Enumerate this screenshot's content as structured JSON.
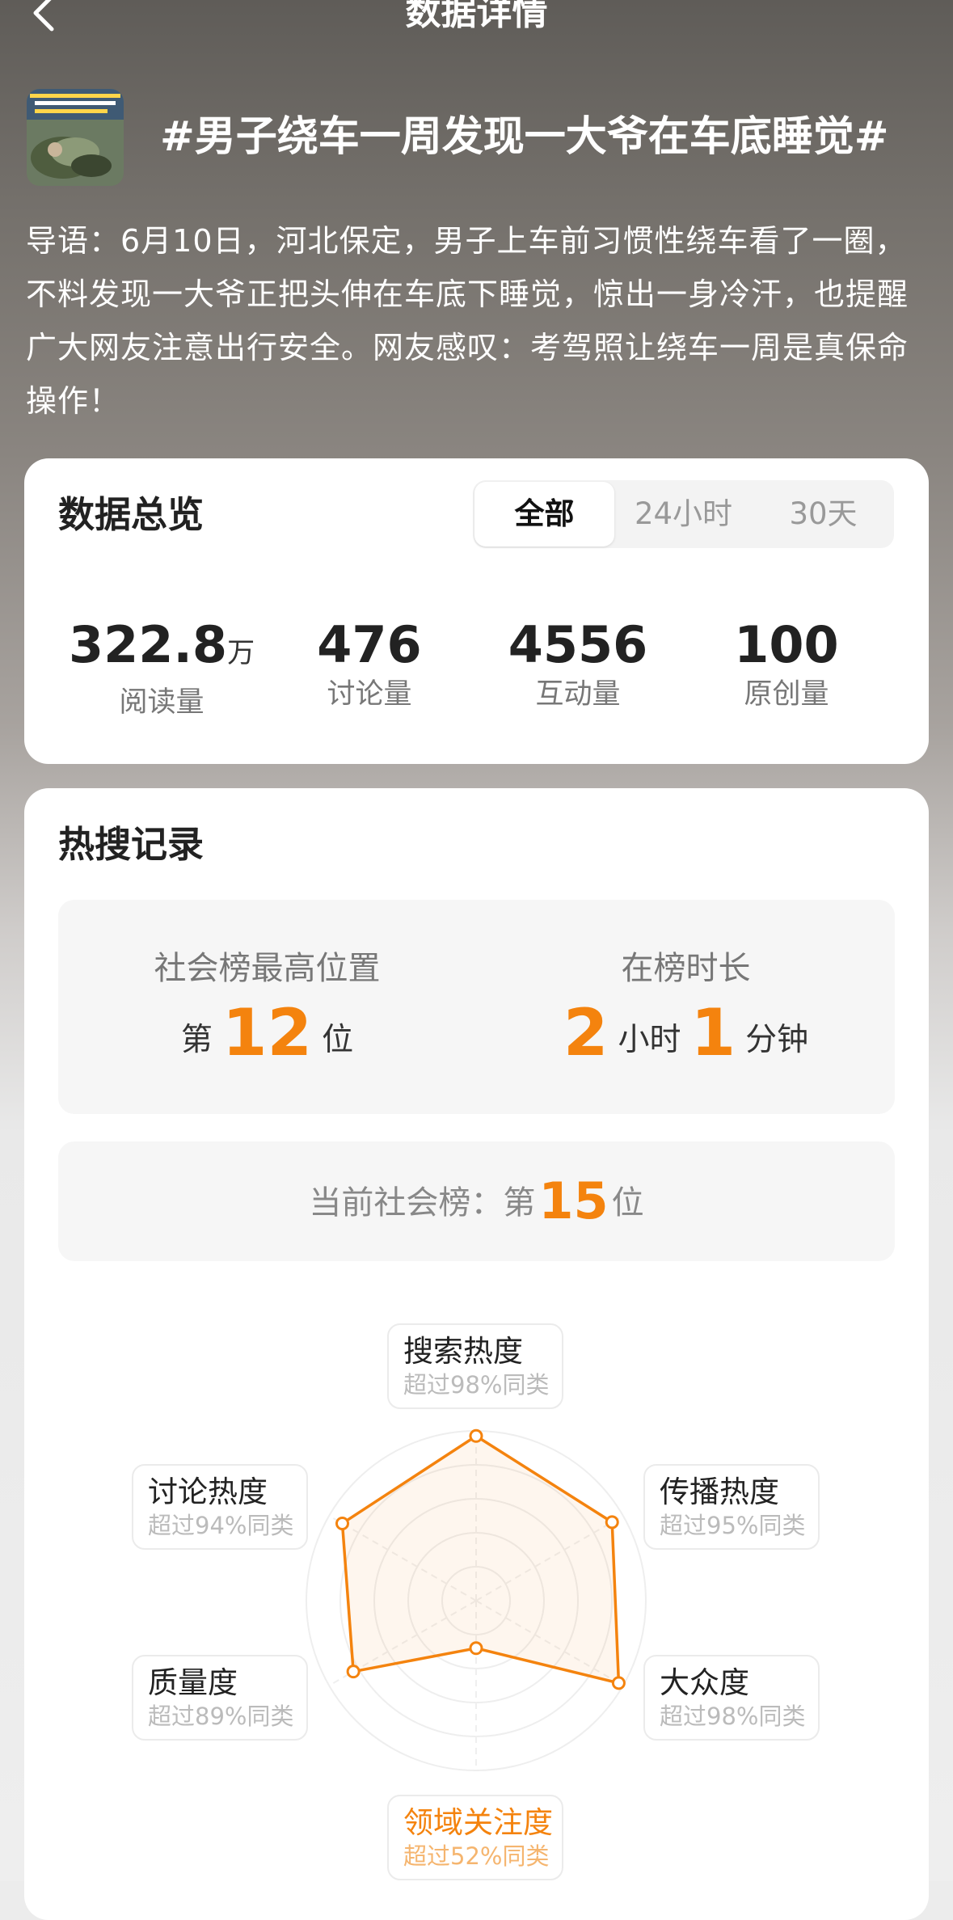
{
  "nav": {
    "title": "数据详情",
    "back_icon": "chevron-left-icon"
  },
  "topic": {
    "title": "#男子绕车一周发现一大爷在车底睡觉#",
    "thumbnail_caption": "男子绕车一周发现一大爷在车底睡觉",
    "intro": "导语：6月10日，河北保定，男子上车前习惯性绕车看了一圈，不料发现一大爷正把头伸在车底下睡觉，惊出一身冷汗，也提醒广大网友注意出行安全。网友感叹：考驾照让绕车一周是真保命操作！"
  },
  "overview": {
    "title": "数据总览",
    "tabs": [
      "全部",
      "24小时",
      "30天"
    ],
    "active_tab": "全部",
    "stats": [
      {
        "value": "322.8",
        "unit": "万",
        "label": "阅读量"
      },
      {
        "value": "476",
        "unit": "",
        "label": "讨论量"
      },
      {
        "value": "4556",
        "unit": "",
        "label": "互动量"
      },
      {
        "value": "100",
        "unit": "",
        "label": "原创量"
      }
    ]
  },
  "hot_search": {
    "title": "热搜记录",
    "highest": {
      "label": "社会榜最高位置",
      "prefix": "第",
      "value": "12",
      "suffix": "位"
    },
    "duration": {
      "label": "在榜时长",
      "hours": "2",
      "hours_unit": "小时",
      "minutes": "1",
      "minutes_unit": "分钟"
    },
    "current": {
      "label": "当前社会榜：第",
      "value": "15",
      "suffix": "位"
    }
  },
  "radar": {
    "accent_color": "#f4830e",
    "axes": [
      {
        "name": "搜索热度",
        "sub": "超过98%同类",
        "percent": 98
      },
      {
        "name": "传播热度",
        "sub": "超过95%同类",
        "percent": 95
      },
      {
        "name": "大众度",
        "sub": "超过98%同类",
        "percent": 98
      },
      {
        "name": "领域关注度",
        "sub": "超过52%同类",
        "percent": 52,
        "highlight": true
      },
      {
        "name": "质量度",
        "sub": "超过89%同类",
        "percent": 89
      },
      {
        "name": "讨论热度",
        "sub": "超过94%同类",
        "percent": 94
      }
    ]
  }
}
